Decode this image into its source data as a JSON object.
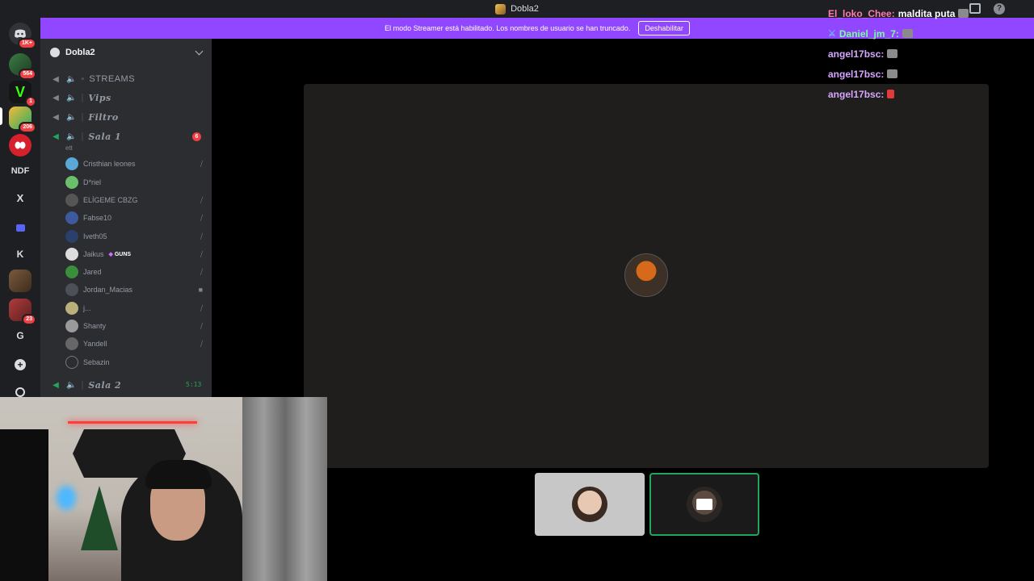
{
  "window": {
    "title": "Dobla2"
  },
  "banner": {
    "text": "El modo Streamer está habilitado. Los nombres de usuario se han truncado.",
    "button": "Deshabilitar"
  },
  "rail": {
    "servers": [
      {
        "name": "discord-home",
        "badge": "1K+"
      },
      {
        "name": "server-1",
        "badge": "564"
      },
      {
        "name": "server-2",
        "badge": "1"
      },
      {
        "name": "server-3",
        "badge": "206"
      },
      {
        "name": "server-4",
        "badge": ""
      },
      {
        "name": "NDF",
        "badge": ""
      },
      {
        "name": "X",
        "badge": ""
      },
      {
        "name": "folder",
        "badge": ""
      },
      {
        "name": "K",
        "badge": ""
      },
      {
        "name": "server-5",
        "badge": ""
      },
      {
        "name": "server-6",
        "badge": "23"
      },
      {
        "name": "G",
        "badge": ""
      }
    ],
    "labels": {
      "ndf": "NDF",
      "x": "X",
      "k": "K",
      "g": "G"
    }
  },
  "sidebar": {
    "guild_name": "Dobla2",
    "channels": {
      "streams": "STREAMS",
      "vips": "Vips",
      "filtro": "Filtro",
      "sala1": "Sala 1",
      "sala1_badge": "6",
      "sala1_status": "ett",
      "sala2": "Sala 2",
      "sala2_timer": "5:13"
    },
    "members": [
      "Cristhian leones",
      "D*riel",
      "ELÍGEME CBZG",
      "Fabse10",
      "Iveth05",
      "Jaikus",
      "Jared",
      "Jordan_Macias",
      "j...",
      "Shanty",
      "Yandell",
      "Sebazin"
    ],
    "member_tag": "GUNS"
  },
  "chat": [
    {
      "user": "El_loko_Chee:",
      "message": "maldita puta"
    },
    {
      "user": "Daniel_jm_7:",
      "message": ""
    },
    {
      "user": "angel17bsc:",
      "message": ""
    },
    {
      "user": "angel17bsc:",
      "message": ""
    },
    {
      "user": "angel17bsc:",
      "message": ""
    }
  ],
  "colors": {
    "banner": "#9146ff",
    "speaking": "#23a55a",
    "mention": "#f23f43"
  }
}
